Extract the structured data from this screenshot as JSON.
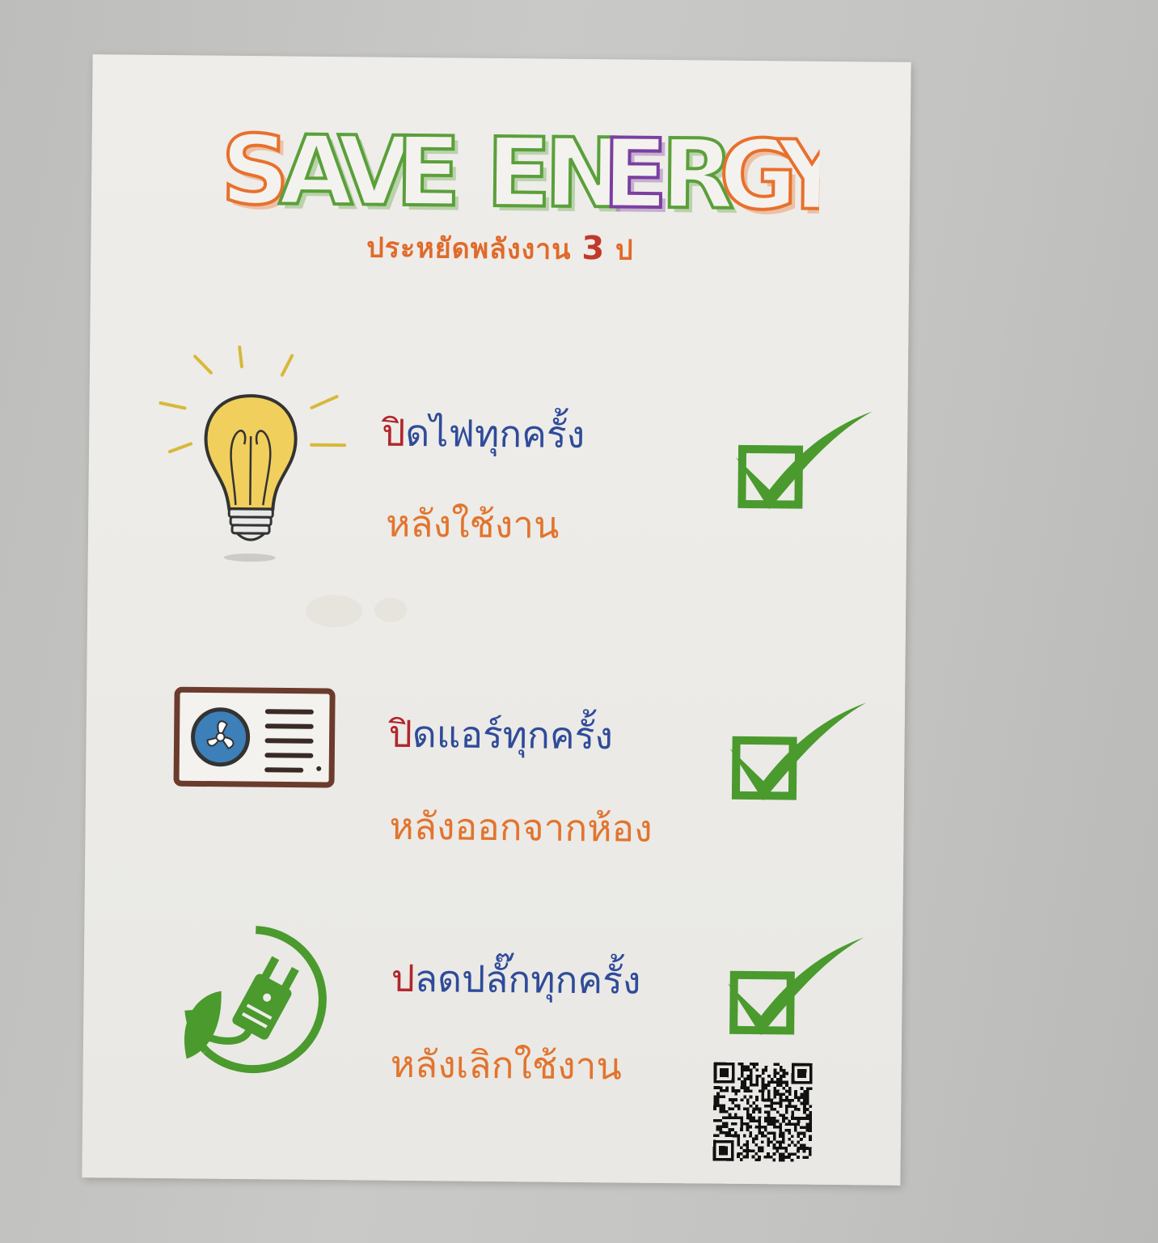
{
  "poster": {
    "title": "SAVE ENERGY",
    "subtitle_text": "ประหยัดพลังงาน ",
    "subtitle_number": "3",
    "subtitle_suffix": " ป",
    "colors": {
      "title_letters": [
        "#e8702c",
        "#5aa03a",
        "#5aa03a",
        "#5aa03a",
        "#5aa03a",
        "#5aa03a",
        "#7a3fa0",
        "#5aa03a",
        "#e8702c",
        "#e8702c"
      ],
      "subtitle": "#e06a2a",
      "line1_first_char": "#b1262c",
      "line1": "#2f4b9a",
      "line2": "#e2742e",
      "check": "#4a9a2e"
    },
    "items": [
      {
        "icon": "light-bulb-icon",
        "line1_first": "ปิ",
        "line1_rest": "ดไฟทุกครั้ง",
        "line2": "หลังใช้งาน"
      },
      {
        "icon": "air-conditioner-icon",
        "line1_first": "ปิ",
        "line1_rest": "ดแอร์ทุกครั้ง",
        "line2": "หลังออกจากห้อง"
      },
      {
        "icon": "eco-plug-icon",
        "line1_first": "ป",
        "line1_rest": "ลดปลั๊กทุกครั้ง",
        "line2": "หลังเลิกใช้งาน"
      }
    ],
    "qr_icon": "qr-code-icon"
  }
}
